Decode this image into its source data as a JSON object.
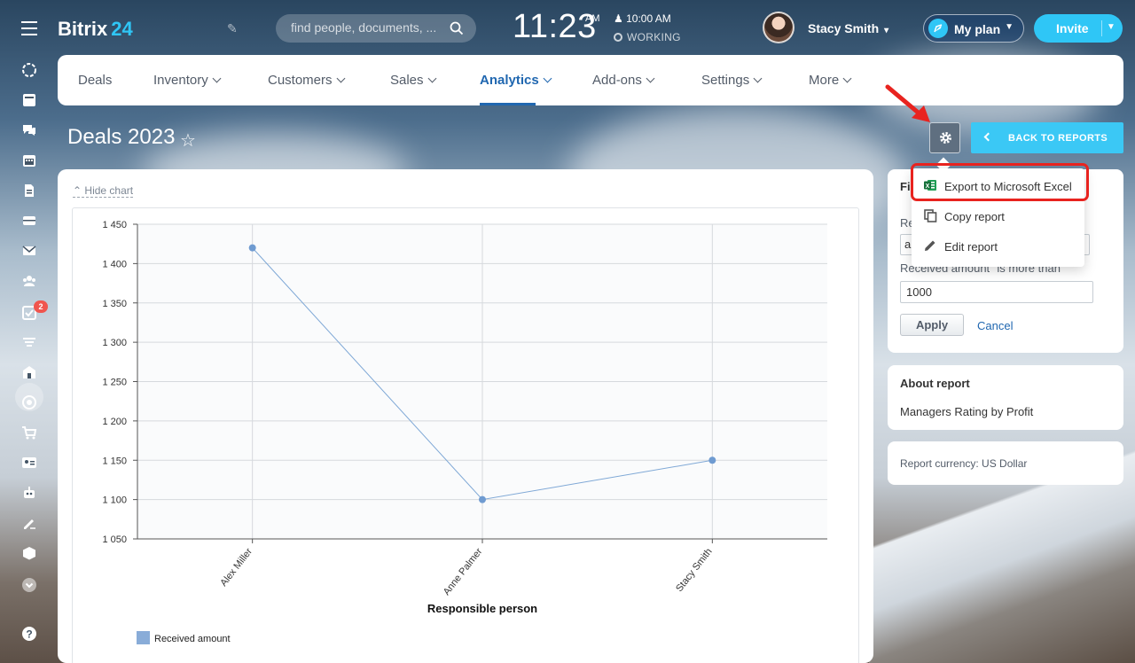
{
  "app": {
    "name": "Bitrix",
    "name_num": "24"
  },
  "search": {
    "placeholder": "find people, documents, ..."
  },
  "clock": {
    "time": "11:23",
    "ampm": "AM",
    "alarm": "10:00 AM",
    "status": "WORKING"
  },
  "user": {
    "name": "Stacy Smith"
  },
  "header_buttons": {
    "my_plan": "My plan",
    "invite": "Invite"
  },
  "sidebar": {
    "tasks_badge": "2"
  },
  "nav": {
    "items": [
      {
        "label": "Deals"
      },
      {
        "label": "Inventory"
      },
      {
        "label": "Customers"
      },
      {
        "label": "Sales"
      },
      {
        "label": "Analytics"
      },
      {
        "label": "Add-ons"
      },
      {
        "label": "Settings"
      },
      {
        "label": "More"
      }
    ],
    "active": "Analytics"
  },
  "page": {
    "title": "Deals 2023",
    "back_button": "BACK TO REPORTS"
  },
  "chart_panel": {
    "hide_chart": "Hide chart"
  },
  "dropdown": {
    "items": [
      {
        "label": "Export to Microsoft Excel",
        "icon": "excel-icon"
      },
      {
        "label": "Copy report",
        "icon": "copy-icon"
      },
      {
        "label": "Edit report",
        "icon": "pencil-icon"
      }
    ]
  },
  "filter": {
    "heading": "Fi",
    "label1": "Re",
    "select_value": "a",
    "label2": "Received amount \"is more than\"",
    "input_value": "1000",
    "apply": "Apply",
    "cancel": "Cancel"
  },
  "about": {
    "heading": "About report",
    "text": "Managers Rating by Profit"
  },
  "currency": {
    "text": "Report currency: US Dollar"
  },
  "colors": {
    "accent": "#2fc6f6",
    "nav_active": "#2067b0",
    "series": "#7fa8d6",
    "highlight": "#e8231f"
  },
  "chart_data": {
    "type": "line",
    "categories": [
      "Alex Miller",
      "Anne Palmer",
      "Stacy Smith"
    ],
    "series": [
      {
        "name": "Received amount",
        "values": [
          1420,
          1100,
          1150
        ]
      }
    ],
    "xlabel": "Responsible person",
    "ylabel": "",
    "ylim": [
      1050,
      1450
    ],
    "yticks": [
      1050,
      1100,
      1150,
      1200,
      1250,
      1300,
      1350,
      1400,
      1450
    ],
    "ytick_labels": [
      "1 050",
      "1 100",
      "1 150",
      "1 200",
      "1 250",
      "1 300",
      "1 350",
      "1 400",
      "1 450"
    ],
    "grid": true,
    "legend": "bottom-left"
  }
}
